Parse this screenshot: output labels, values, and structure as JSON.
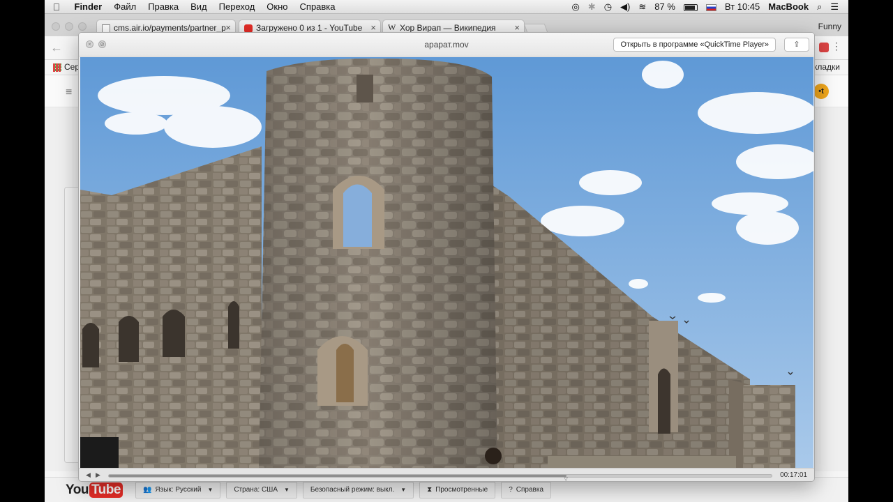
{
  "menubar": {
    "app": "Finder",
    "items": [
      "Файл",
      "Правка",
      "Вид",
      "Переход",
      "Окно",
      "Справка"
    ],
    "battery": "87 %",
    "clock": "Вт 10:45",
    "computer": "MacBook"
  },
  "chrome": {
    "tabs": [
      {
        "title": "cms.air.io/payments/partner_p"
      },
      {
        "title": "Загружено 0 из 1 - YouTube"
      },
      {
        "title": "Хор Вирап — Википедия",
        "favicon": "W"
      }
    ],
    "profile": "Funny",
    "bookmarks_left": "Сер",
    "bookmarks_right": "кладки",
    "avatar_text": "•t"
  },
  "quicktime": {
    "filename": "арарат.mov",
    "open_button": "Открыть в программе «QuickTime Player»",
    "time": "00:17:01",
    "progress": 0.69
  },
  "youtube_footer": {
    "logo_you": "You",
    "logo_tube": "Tube",
    "language": "Язык: Русский",
    "country": "Страна: США",
    "safe_mode": "Безопасный режим: выкл.",
    "history": "Просмотренные",
    "help": "Справка"
  },
  "colors": {
    "youtube_red": "#e52d27",
    "sky": "#7fb0e0",
    "stone": "#8d8478"
  }
}
